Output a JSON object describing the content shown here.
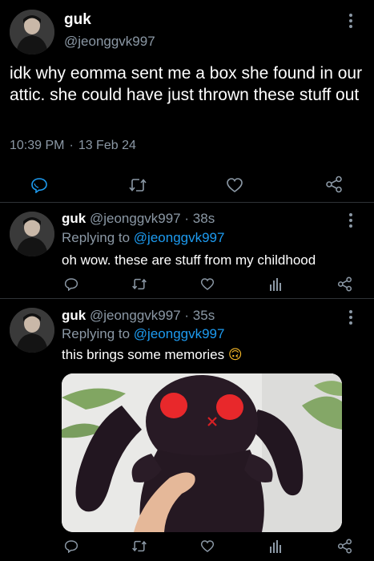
{
  "main_tweet": {
    "name": "guk",
    "handle": "@jeonggvk997",
    "text": "idk why eomma sent me a box she found in our attic. she could have just thrown these stuff out",
    "time": "10:39 PM",
    "date": "13 Feb 24",
    "separator": "·",
    "icons": [
      "reply-icon",
      "retweet-icon",
      "like-icon",
      "share-icon"
    ]
  },
  "replies": [
    {
      "name": "guk",
      "handle": "@jeonggvk997",
      "separator": "·",
      "age": "38s",
      "replying_label": "Replying to",
      "replying_handle": "@jeonggvk997",
      "text": "oh wow. these are stuff from my childhood"
    },
    {
      "name": "guk",
      "handle": "@jeonggvk997",
      "separator": "·",
      "age": "35s",
      "replying_label": "Replying to",
      "replying_handle": "@jeonggvk997",
      "text": "this brings some memories",
      "emoji": "🙃"
    }
  ],
  "colors": {
    "background": "#000000",
    "secondary_text": "#8b98a5",
    "link": "#1d9bf0",
    "divider": "#2f3336",
    "emoji": "#f7b928"
  }
}
